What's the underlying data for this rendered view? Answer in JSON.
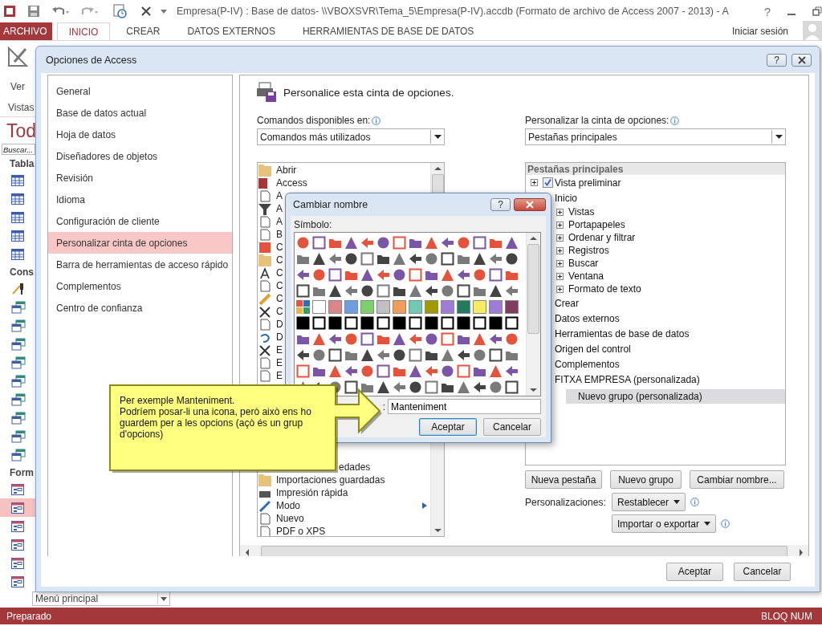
{
  "app": {
    "title": "Empresa(P-IV) : Base de datos- \\\\VBOXSVR\\Tema_5\\Empresa(P-IV).accdb (Formato de archivo de Access 2007 - 2013) - A",
    "help_button": "?",
    "tabs": [
      {
        "label": "ARCHIVO",
        "kind": "file",
        "selected": false
      },
      {
        "label": "INICIO",
        "kind": "tab",
        "selected": true
      },
      {
        "label": "CREAR",
        "kind": "tab",
        "selected": false
      },
      {
        "label": "DATOS EXTERNOS",
        "kind": "tab",
        "selected": false
      },
      {
        "label": "HERRAMIENTAS DE BASE DE DATOS",
        "kind": "tab",
        "selected": false
      }
    ],
    "sign_in": "Iniciar sesión",
    "ribbon": {
      "view_button": "Ver",
      "group_label": "Vistas"
    },
    "nav_pane": {
      "title": "Tod",
      "search_placeholder": "Buscar...",
      "groups": [
        {
          "header": "Tabla",
          "items": [
            {
              "kind": "table",
              "selected": false
            },
            {
              "kind": "table",
              "selected": false
            },
            {
              "kind": "table",
              "selected": false
            },
            {
              "kind": "table",
              "selected": false
            },
            {
              "kind": "table",
              "selected": false
            }
          ]
        },
        {
          "header": "Cons",
          "items": [
            {
              "kind": "wizard",
              "selected": false
            },
            {
              "kind": "query",
              "selected": false
            },
            {
              "kind": "query",
              "selected": false
            },
            {
              "kind": "query",
              "selected": false
            },
            {
              "kind": "query",
              "selected": false
            },
            {
              "kind": "query",
              "selected": false
            },
            {
              "kind": "query",
              "selected": false
            },
            {
              "kind": "query",
              "selected": false
            },
            {
              "kind": "query",
              "selected": false
            },
            {
              "kind": "query",
              "selected": false
            }
          ]
        },
        {
          "header": "Form",
          "items": [
            {
              "kind": "form",
              "selected": false
            },
            {
              "kind": "form",
              "selected": true
            },
            {
              "kind": "form",
              "selected": false
            },
            {
              "kind": "form",
              "selected": false
            },
            {
              "kind": "form",
              "selected": false
            },
            {
              "kind": "form",
              "selected": false
            }
          ]
        }
      ]
    },
    "form_combo": "Menú principal",
    "status": {
      "left": "Preparado",
      "right": "BLOQ NUM"
    }
  },
  "options_dialog": {
    "title": "Opciones de Access",
    "help_button": "?",
    "categories": [
      {
        "label": "General",
        "selected": false
      },
      {
        "label": "Base de datos actual",
        "selected": false
      },
      {
        "label": "Hoja de datos",
        "selected": false
      },
      {
        "label": "Diseñadores de objetos",
        "selected": false
      },
      {
        "label": "Revisión",
        "selected": false
      },
      {
        "label": "Idioma",
        "selected": false
      },
      {
        "label": "Configuración de cliente",
        "selected": false
      },
      {
        "label": "Personalizar cinta de opciones",
        "selected": true
      },
      {
        "label": "Barra de herramientas de acceso rápido",
        "selected": false
      },
      {
        "label": "Complementos",
        "selected": false
      },
      {
        "label": "Centro de confianza",
        "selected": false
      }
    ],
    "heading": "Personalice esta cinta de opciones.",
    "commands_label": "Comandos disponibles en:",
    "commands_combo": "Comandos más utilizados",
    "ribbon_label": "Personalizar la cinta de opciones:",
    "ribbon_combo": "Pestañas principales",
    "commands": [
      {
        "label": "Abrir"
      },
      {
        "label": "Access"
      },
      {
        "label": "A"
      },
      {
        "label": "A"
      },
      {
        "label": "A"
      },
      {
        "label": "B"
      },
      {
        "label": "C"
      },
      {
        "label": "C"
      },
      {
        "label": "C"
      },
      {
        "label": "C"
      },
      {
        "label": "C"
      },
      {
        "label": "C"
      },
      {
        "label": "D"
      },
      {
        "label": "D"
      },
      {
        "label": "E"
      },
      {
        "label": "E"
      },
      {
        "label": "E"
      }
    ],
    "commands_lower": [
      {
        "label": "edades",
        "kind": "partial"
      },
      {
        "label": "Importaciones guardadas",
        "kind": "item"
      },
      {
        "label": "Impresión rápida",
        "kind": "item"
      },
      {
        "label": "Modo",
        "kind": "submenu"
      },
      {
        "label": "Nuevo",
        "kind": "item"
      },
      {
        "label": "PDF o XPS",
        "kind": "item"
      }
    ],
    "tree_header": "Pestañas principales",
    "tree": [
      {
        "label": "Vista preliminar",
        "expanded": false,
        "checked": true,
        "selected": false
      },
      {
        "label": "Inicio",
        "selected": false,
        "children": [
          {
            "label": "Vistas",
            "expanded": false,
            "selected": false
          },
          {
            "label": "Portapapeles",
            "expanded": false,
            "selected": false
          },
          {
            "label": "Ordenar y filtrar",
            "expanded": false,
            "selected": false
          },
          {
            "label": "Registros",
            "expanded": false,
            "selected": false
          },
          {
            "label": "Buscar",
            "expanded": false,
            "selected": false
          },
          {
            "label": "Ventana",
            "expanded": false,
            "selected": false
          },
          {
            "label": "Formato de texto",
            "expanded": false,
            "selected": false
          }
        ]
      },
      {
        "label": "Crear",
        "selected": false
      },
      {
        "label": "Datos externos",
        "selected": false
      },
      {
        "label": "Herramientas de base de datos",
        "selected": false
      },
      {
        "label": "Origen del control",
        "selected": false
      },
      {
        "label": "Complementos",
        "selected": false
      },
      {
        "label": "FITXA EMPRESA (personalizada)",
        "selected": false,
        "children": [
          {
            "label": "Nuevo grupo (personalizada)",
            "selected": true
          }
        ]
      }
    ],
    "tree_buttons": [
      "Nueva pestaña",
      "Nuevo grupo",
      "Cambiar nombre..."
    ],
    "customizations_label": "Personalizaciones:",
    "reset_button": "Restablecer",
    "import_button": "Importar o exportar",
    "buttons": [
      "Aceptar",
      "Cancelar"
    ]
  },
  "rename_dialog": {
    "title": "Cambiar nombre",
    "help_button": "?",
    "symbol_label": "Símbolo:",
    "name_label": ":",
    "name_value": "Manteniment",
    "buttons": [
      {
        "label": "Aceptar",
        "default": true
      },
      {
        "label": "Cancelar",
        "default": false
      }
    ]
  },
  "callout": {
    "paragraphs": [
      "Per exemple Manteniment.",
      "Podríem posar-li una icona, però això ens ho guardem per a les opcions (açò és un grup d'opcions)"
    ]
  }
}
